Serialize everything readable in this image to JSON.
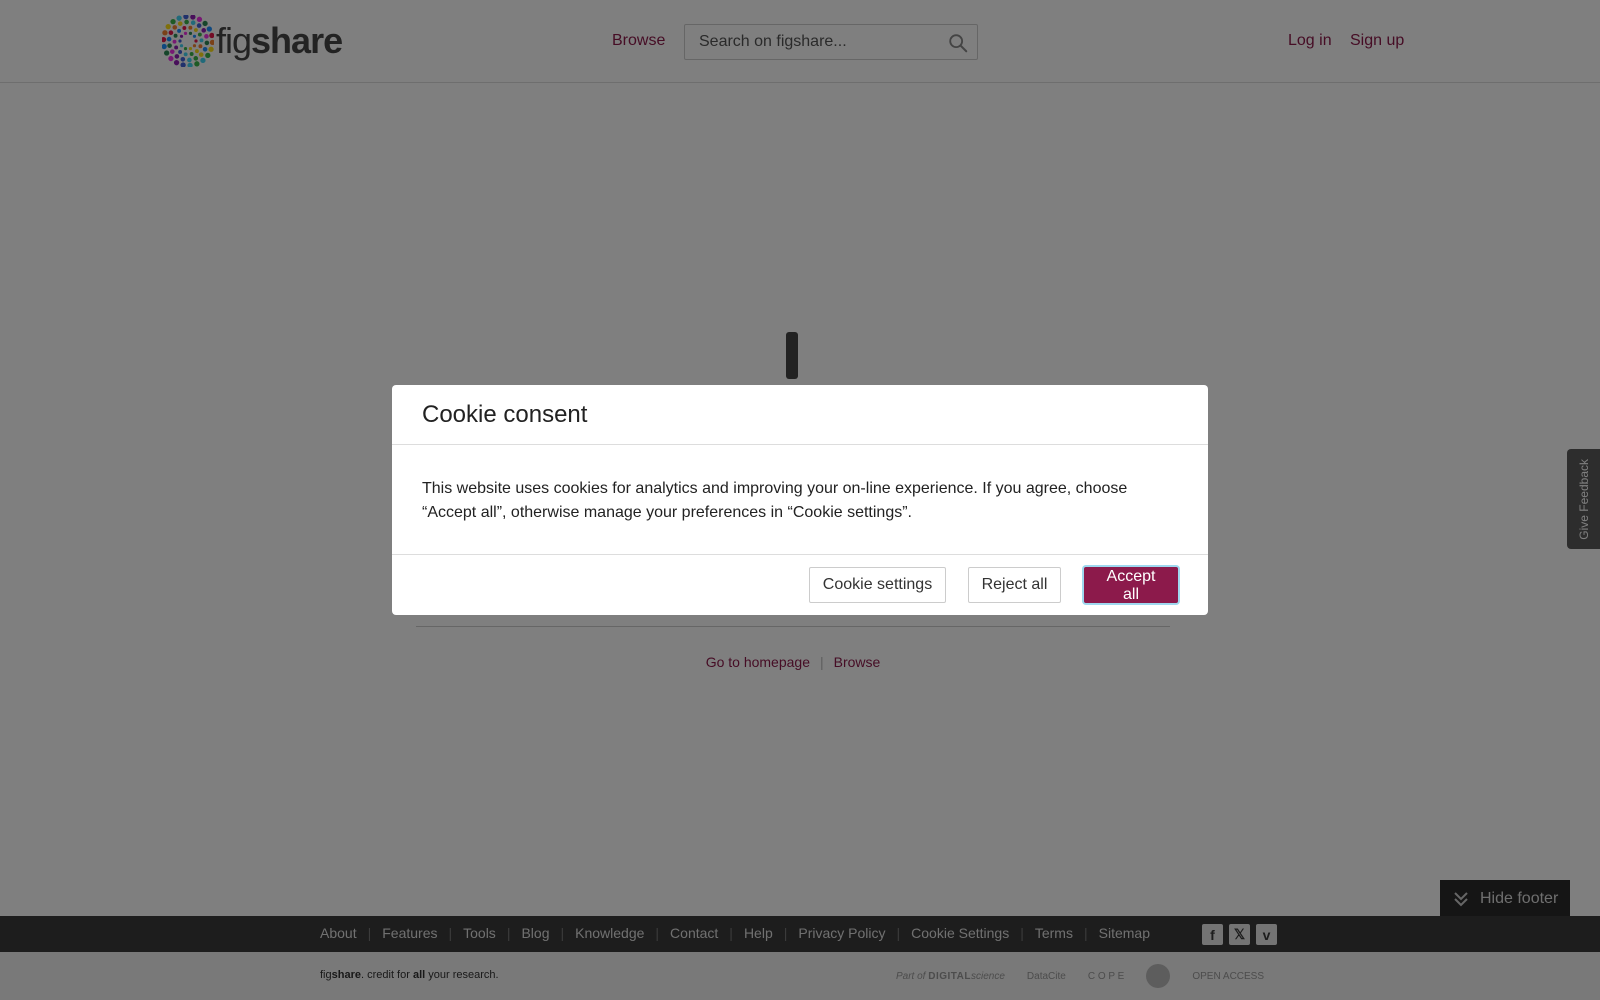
{
  "header": {
    "logo_fig": "fig",
    "logo_share": "share",
    "browse_label": "Browse",
    "search_placeholder": "Search on figshare...",
    "login_label": "Log in",
    "signup_label": "Sign up"
  },
  "page": {
    "links": [
      {
        "label": "Go to homepage"
      },
      {
        "label": "Browse"
      }
    ]
  },
  "feedback": {
    "label": "Give Feedback"
  },
  "hide_footer": {
    "label": "Hide footer"
  },
  "footer": {
    "links": [
      "About",
      "Features",
      "Tools",
      "Blog",
      "Knowledge",
      "Contact",
      "Help",
      "Privacy Policy",
      "Cookie Settings",
      "Terms",
      "Sitemap"
    ],
    "social": [
      {
        "name": "facebook-icon",
        "glyph": "f"
      },
      {
        "name": "x-icon",
        "glyph": "𝕏"
      },
      {
        "name": "vimeo-icon",
        "glyph": "v"
      }
    ],
    "tagline": {
      "fig": "fig",
      "share": "share",
      "mid": ". credit for ",
      "all": "all",
      "end": " your research."
    },
    "partners": {
      "part_of": "Part of",
      "digital": "DIGITAL",
      "science": "science",
      "datacite": "DataCite",
      "cope": "C O P E",
      "open_access": "OPEN ACCESS"
    }
  },
  "modal": {
    "title": "Cookie consent",
    "body": "This website uses cookies for analytics and improving your on-line experience. If you agree, choose “Accept all”, otherwise manage your preferences in “Cookie settings”.",
    "settings_label": "Cookie settings",
    "reject_label": "Reject all",
    "accept_label": "Accept all"
  },
  "colors": {
    "accent": "#8c1a4b",
    "footer_dark": "#3a3a3a",
    "overlay": "rgba(0,0,0,0.5)"
  }
}
